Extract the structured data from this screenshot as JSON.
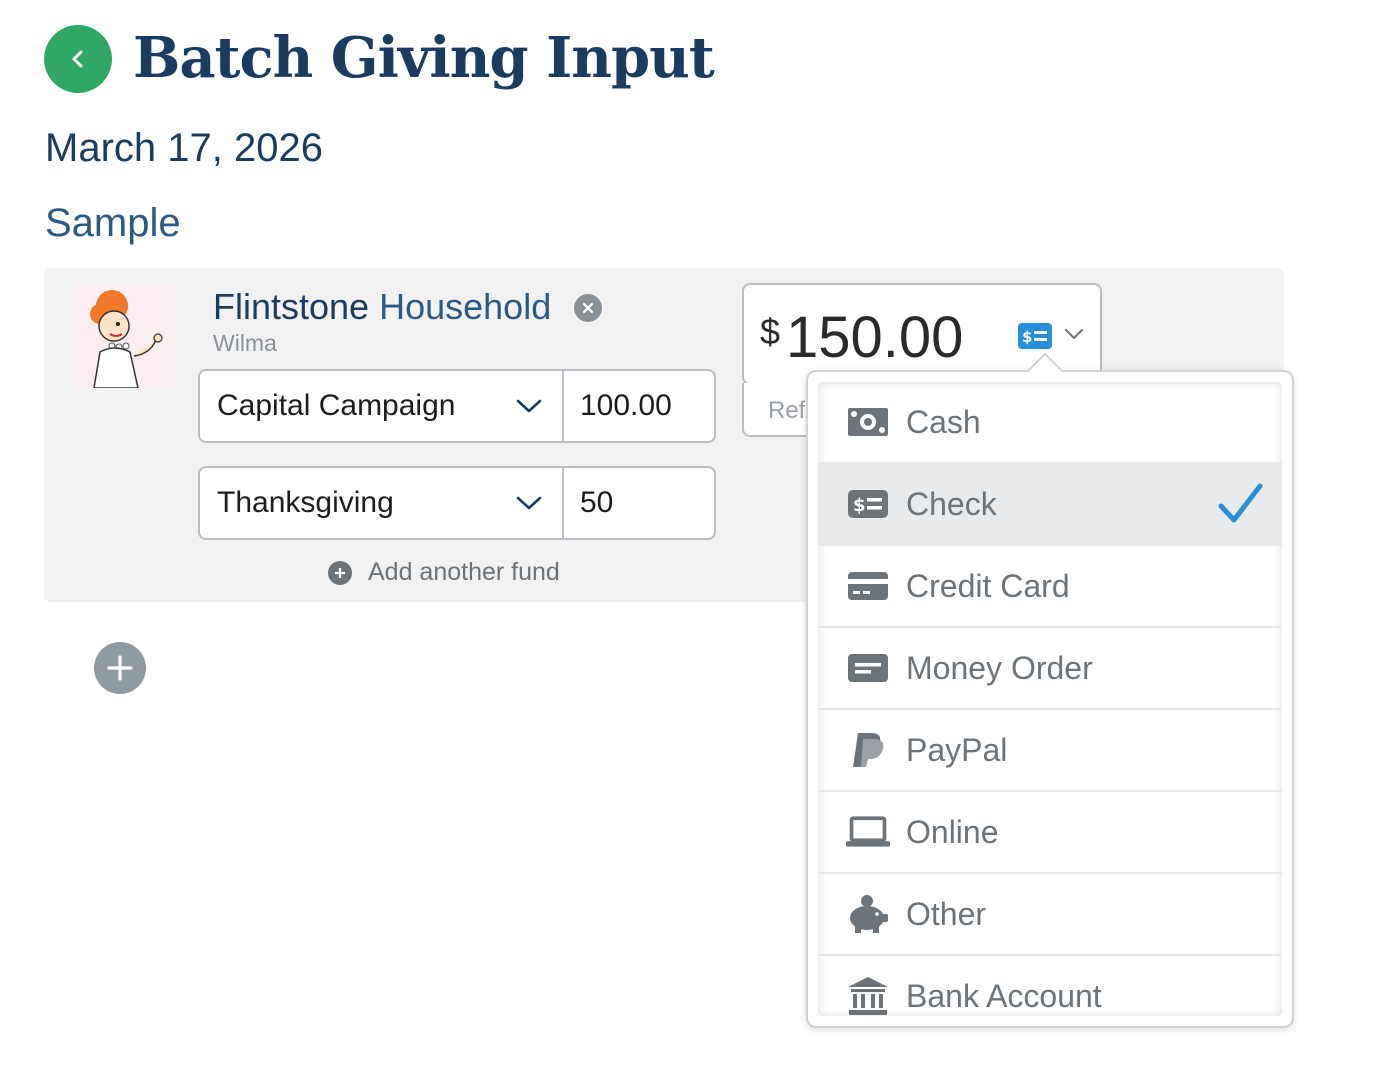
{
  "header": {
    "title": "Batch Giving Input",
    "date": "March 17, 2026",
    "batch_name": "Sample"
  },
  "donor": {
    "first_name": "Flintstone",
    "last_name": "Household",
    "sub_name": "Wilma",
    "funds": [
      {
        "name": "Capital Campaign",
        "amount": "100.00"
      },
      {
        "name": "Thanksgiving",
        "amount": "50"
      }
    ],
    "add_fund_label": "Add another fund"
  },
  "total": {
    "currency": "$",
    "amount": "150.00",
    "reference_placeholder": "Refe",
    "selected_method_icon": "check-icon"
  },
  "payment_methods": [
    {
      "label": "Cash",
      "icon": "cash-icon",
      "selected": false
    },
    {
      "label": "Check",
      "icon": "check-icon",
      "selected": true
    },
    {
      "label": "Credit Card",
      "icon": "credit-card-icon",
      "selected": false
    },
    {
      "label": "Money Order",
      "icon": "money-order-icon",
      "selected": false
    },
    {
      "label": "PayPal",
      "icon": "paypal-icon",
      "selected": false
    },
    {
      "label": "Online",
      "icon": "laptop-icon",
      "selected": false
    },
    {
      "label": "Other",
      "icon": "piggy-bank-icon",
      "selected": false
    },
    {
      "label": "Bank Account",
      "icon": "bank-icon",
      "selected": false
    }
  ],
  "colors": {
    "title": "#1b3b5f",
    "back_button": "#2fa866",
    "accent_blue": "#2a8fd6",
    "card_bg": "#f2f2f2"
  }
}
